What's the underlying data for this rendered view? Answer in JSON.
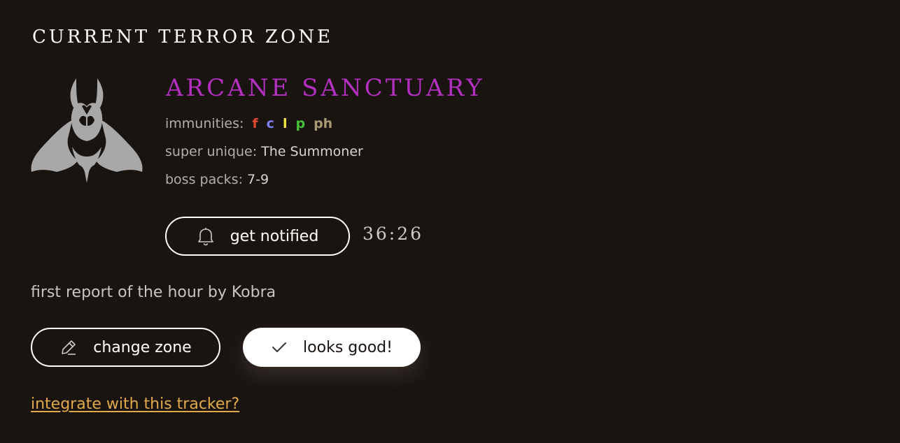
{
  "section": {
    "title": "Current Terror Zone"
  },
  "zone": {
    "name": "Arcane Sanctuary",
    "name_color": "#b22fc0",
    "emblem_icon": "horned-demon-emblem-icon",
    "emblem_color": "#a8a8a8"
  },
  "immunities": {
    "label": "immunities:",
    "items": [
      {
        "text": "f",
        "color": "#e0452f"
      },
      {
        "text": "c",
        "color": "#7d82f0"
      },
      {
        "text": "l",
        "color": "#f3e343"
      },
      {
        "text": "p",
        "color": "#45c23a"
      },
      {
        "text": "ph",
        "color": "#a89a72"
      }
    ]
  },
  "super_unique": {
    "label": "super unique:",
    "value": "The Summoner"
  },
  "boss_packs": {
    "label": "boss packs:",
    "value": "7-9"
  },
  "notify": {
    "label": "get notified",
    "icon": "bell-icon"
  },
  "timer": "36:26",
  "report_text": "first report of the hour by Kobra",
  "actions": {
    "change_label": "change zone",
    "change_icon": "pencil-icon",
    "good_label": "looks good!",
    "good_icon": "checkmark-icon"
  },
  "integrate_link": {
    "text": "integrate with this tracker?",
    "color": "#e0a94a"
  }
}
